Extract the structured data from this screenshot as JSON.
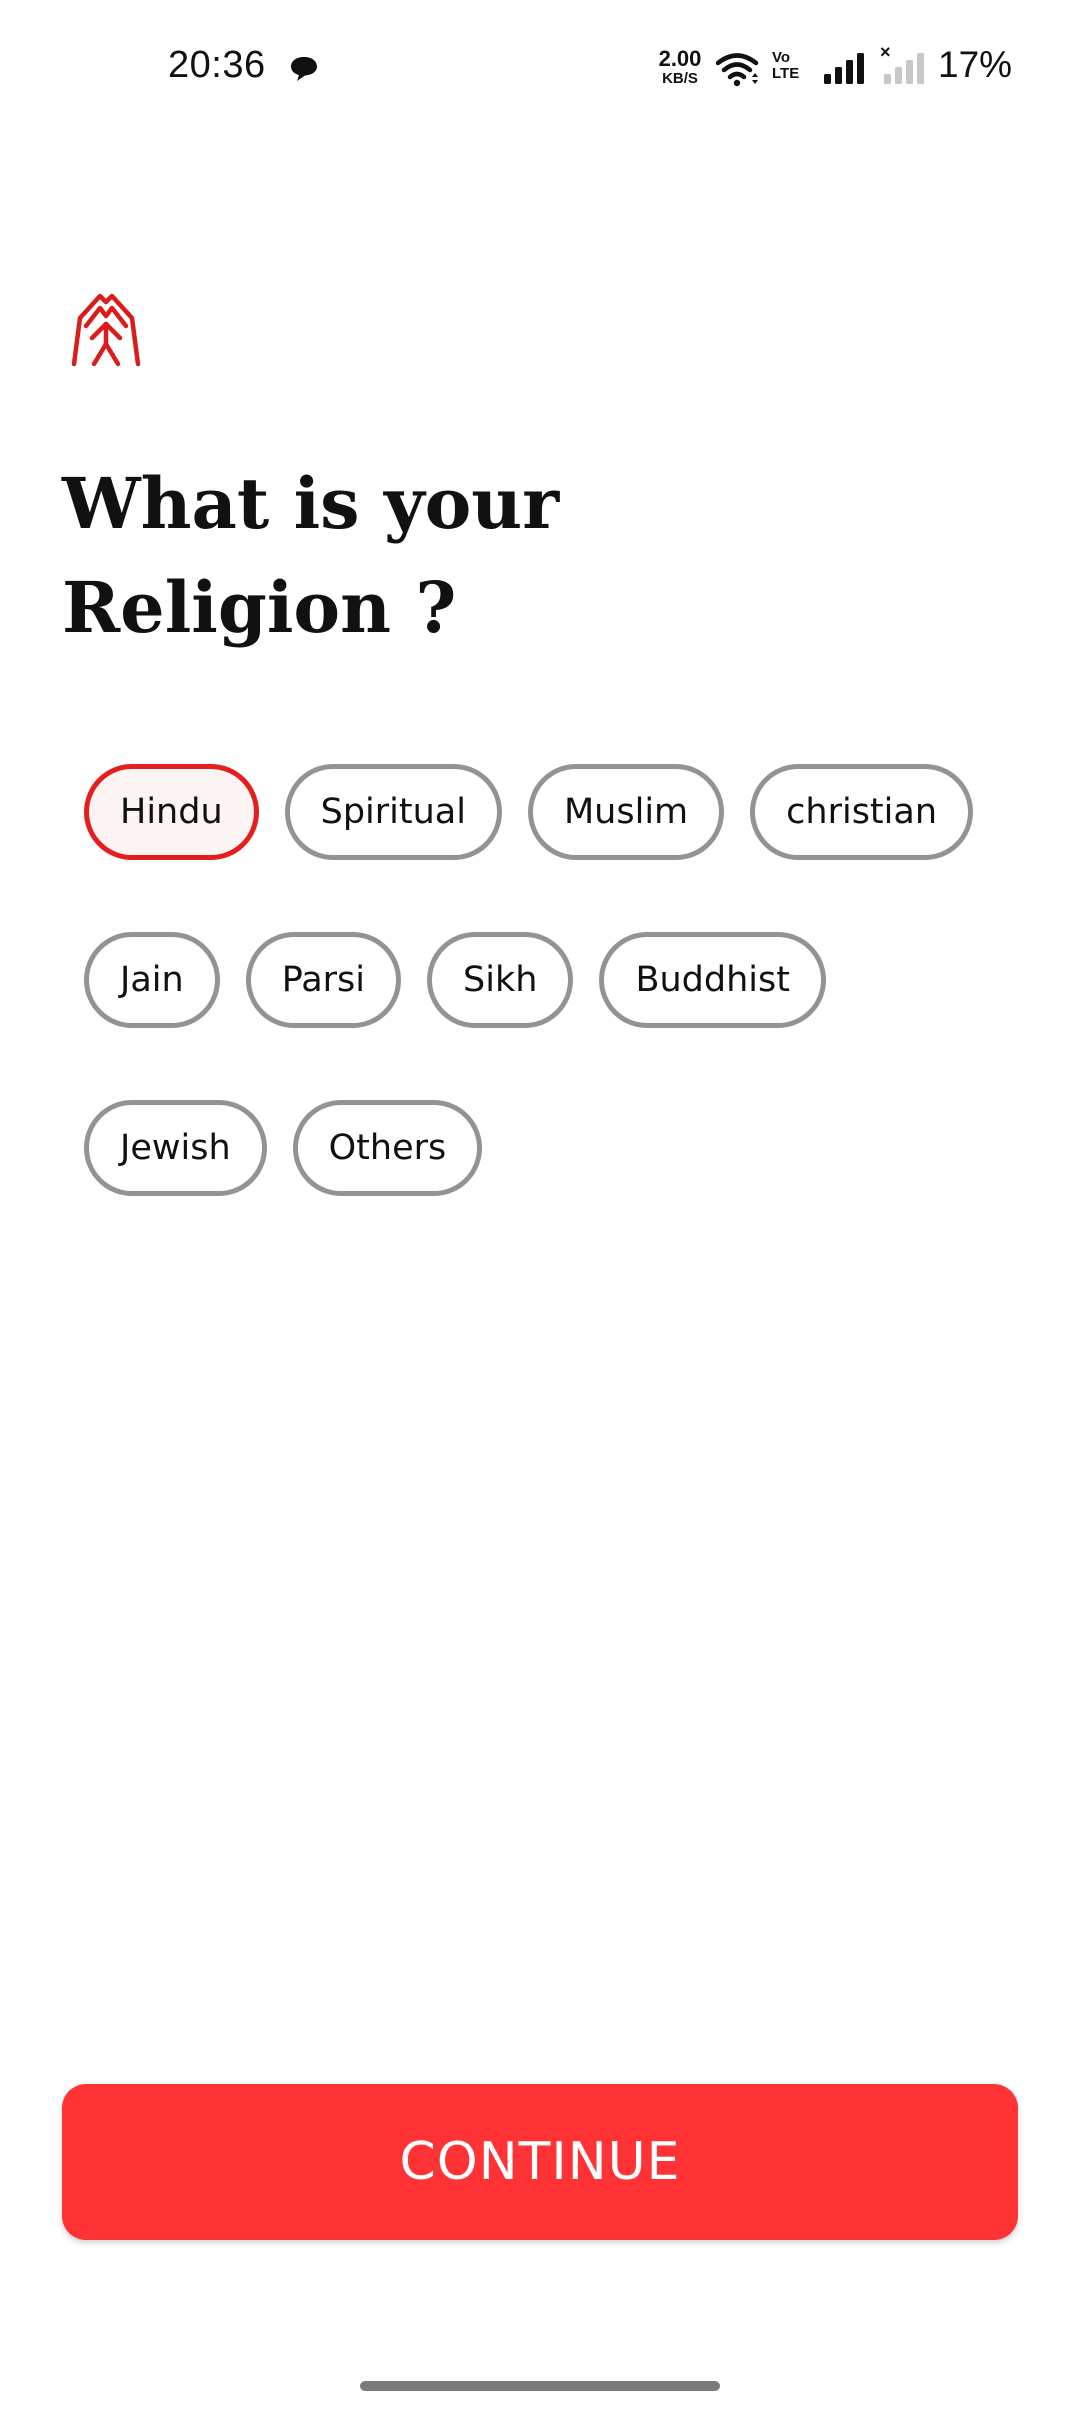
{
  "status_bar": {
    "time": "20:36",
    "net_speed_value": "2.00",
    "net_speed_unit": "KB/S",
    "volte_top": "Vo",
    "volte_bottom": "LTE",
    "sim2_indicator": "×",
    "battery": "17%",
    "icons": [
      "message-bubble-icon",
      "wifi-icon",
      "volte-icon",
      "signal-strength-icon",
      "signal-no-service-icon"
    ]
  },
  "header": {
    "logo": "praying-hands-logo",
    "title_line1": "What is your",
    "title_line2": "Religion ?"
  },
  "options": {
    "selected": "Hindu",
    "items": [
      {
        "label": "Hindu"
      },
      {
        "label": "Spiritual"
      },
      {
        "label": "Muslim"
      },
      {
        "label": "christian"
      },
      {
        "label": "Jain"
      },
      {
        "label": "Parsi"
      },
      {
        "label": "Sikh"
      },
      {
        "label": "Buddhist"
      },
      {
        "label": "Jewish"
      },
      {
        "label": "Others"
      }
    ]
  },
  "footer": {
    "continue_label": "CONTINUE"
  },
  "colors": {
    "accent": "#ff3236",
    "selected_border": "#e41e1e",
    "chip_border": "#939393",
    "logo": "#d91c1c"
  }
}
